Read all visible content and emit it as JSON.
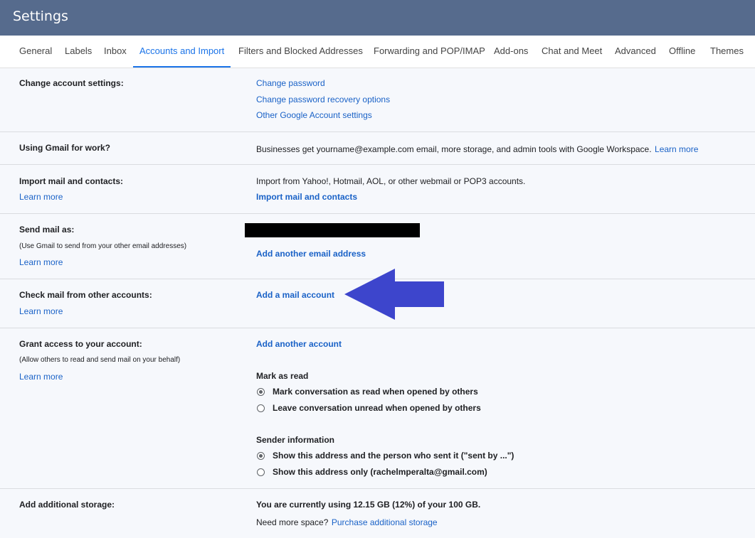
{
  "app": {
    "title": "Settings"
  },
  "tabs": [
    "General",
    "Labels",
    "Inbox",
    "Accounts and Import",
    "Filters and Blocked Addresses",
    "Forwarding and POP/IMAP",
    "Add-ons",
    "Chat and Meet",
    "Advanced",
    "Offline",
    "Themes"
  ],
  "change_account": {
    "label": "Change account settings:",
    "links": [
      "Change password",
      "Change password recovery options",
      "Other Google Account settings"
    ]
  },
  "gmail_work": {
    "label": "Using Gmail for work?",
    "text": "Businesses get yourname@example.com email, more storage, and admin tools with Google Workspace.",
    "link": "Learn more"
  },
  "import_mail": {
    "label": "Import mail and contacts:",
    "learn_more": "Learn more",
    "text": "Import from Yahoo!, Hotmail, AOL, or other webmail or POP3 accounts.",
    "action": "Import mail and contacts"
  },
  "send_as": {
    "label": "Send mail as:",
    "note": "(Use Gmail to send from your other email addresses)",
    "learn_more": "Learn more",
    "action": "Add another email address"
  },
  "check_mail": {
    "label": "Check mail from other accounts:",
    "learn_more": "Learn more",
    "action": "Add a mail account"
  },
  "grant_access": {
    "label": "Grant access to your account:",
    "note": "(Allow others to read and send mail on your behalf)",
    "learn_more": "Learn more",
    "action": "Add another account",
    "mark_heading": "Mark as read",
    "mark_options": [
      "Mark conversation as read when opened by others",
      "Leave conversation unread when opened by others"
    ],
    "mark_selected": 0,
    "sender_heading": "Sender information",
    "sender_options": [
      "Show this address and the person who sent it (\"sent by ...\")",
      "Show this address only (rachelmperalta@gmail.com)"
    ],
    "sender_selected": 0
  },
  "storage": {
    "label": "Add additional storage:",
    "usage": "You are currently using 12.15 GB (12%) of your 100 GB.",
    "prompt": "Need more space?",
    "link": "Purchase additional storage"
  },
  "colors": {
    "header": "#566b8d",
    "link": "#1a62c7",
    "active_tab": "#1a73e8",
    "arrow": "#3d45cc"
  },
  "icons": {
    "annotation": "left-arrow-icon"
  }
}
